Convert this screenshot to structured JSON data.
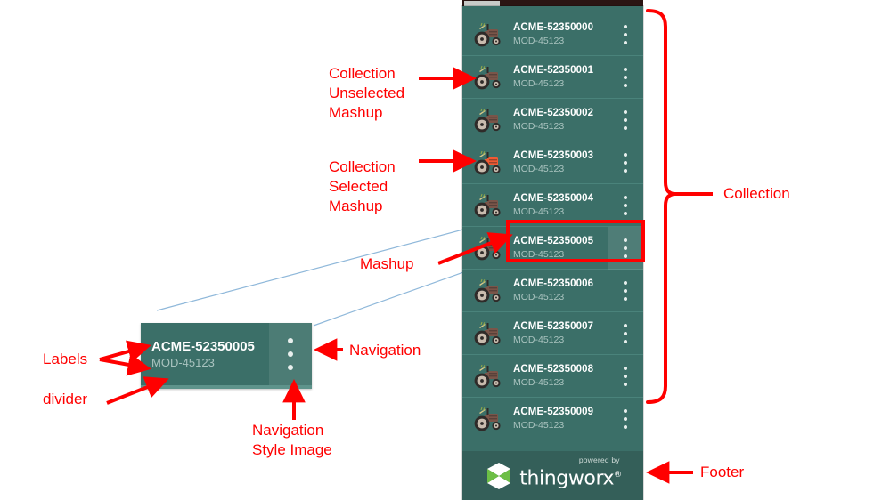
{
  "panel": {
    "scrollbar": {
      "name": "horizontal-scrollbar"
    },
    "items": [
      {
        "title": "ACME-52350000",
        "subtitle": "MOD-45123",
        "tractor_color": "#7a5549",
        "selected": false,
        "nav_highlight": false
      },
      {
        "title": "ACME-52350001",
        "subtitle": "MOD-45123",
        "tractor_color": "#7a5549",
        "selected": false,
        "nav_highlight": false
      },
      {
        "title": "ACME-52350002",
        "subtitle": "MOD-45123",
        "tractor_color": "#7a5549",
        "selected": false,
        "nav_highlight": false
      },
      {
        "title": "ACME-52350003",
        "subtitle": "MOD-45123",
        "tractor_color": "#f05a33",
        "selected": true,
        "nav_highlight": false
      },
      {
        "title": "ACME-52350004",
        "subtitle": "MOD-45123",
        "tractor_color": "#7a5549",
        "selected": false,
        "nav_highlight": false
      },
      {
        "title": "ACME-52350005",
        "subtitle": "MOD-45123",
        "tractor_color": "#7a5549",
        "selected": false,
        "nav_highlight": true
      },
      {
        "title": "ACME-52350006",
        "subtitle": "MOD-45123",
        "tractor_color": "#7a5549",
        "selected": false,
        "nav_highlight": false
      },
      {
        "title": "ACME-52350007",
        "subtitle": "MOD-45123",
        "tractor_color": "#7a5549",
        "selected": false,
        "nav_highlight": false
      },
      {
        "title": "ACME-52350008",
        "subtitle": "MOD-45123",
        "tractor_color": "#7a5549",
        "selected": false,
        "nav_highlight": false
      },
      {
        "title": "ACME-52350009",
        "subtitle": "MOD-45123",
        "tractor_color": "#7a5549",
        "selected": false,
        "nav_highlight": false
      }
    ],
    "footer": {
      "powered_by": "powered by",
      "brand": "thingworx",
      "registered_mark": "®",
      "logo_icon": "thingworx-bowtie-logo"
    }
  },
  "detail_card": {
    "title": "ACME-52350005",
    "subtitle": "MOD-45123",
    "nav_icon": "vertical-three-dots-icon"
  },
  "annotations": {
    "collection_unselected": "Collection\nUnselected\nMashup",
    "collection_selected": "Collection\nSelected\nMashup",
    "mashup": "Mashup",
    "collection": "Collection",
    "footer": "Footer",
    "navigation": "Navigation",
    "navigation_style_image": "Navigation\nStyle Image",
    "labels": "Labels",
    "divider": "divider"
  },
  "colors": {
    "panel_bg": "#3b6f68",
    "footer_bg": "#345f59",
    "divider": "#4a837b",
    "title_text": "#ffffff",
    "subtitle_text": "#a9c3bf",
    "annotation_red": "#ff0000",
    "callout_blue": "#8fb8da",
    "scrollbar_track": "#2b1513",
    "scrollbar_thumb": "#c9cbc8"
  }
}
